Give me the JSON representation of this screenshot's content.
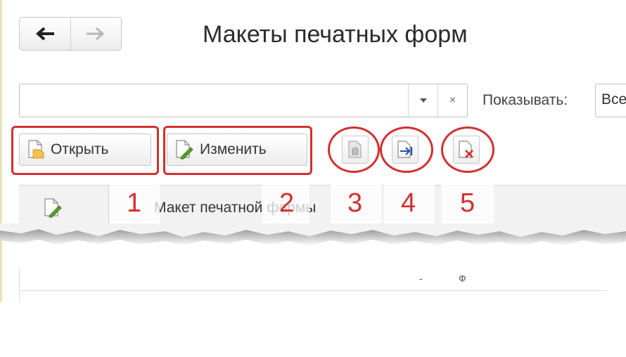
{
  "window": {
    "title": "Макеты печатных форм"
  },
  "nav": {
    "back_icon": "arrow-left-icon",
    "forward_icon": "arrow-right-icon"
  },
  "search": {
    "value": "",
    "placeholder": "",
    "dropdown_icon": "chevron-down-icon",
    "clear_label": "×"
  },
  "filter": {
    "label": "Показывать:",
    "value": "Все"
  },
  "toolbar": {
    "open_label": "Открыть",
    "edit_label": "Изменить",
    "icon3": "use-standard-layout-icon",
    "icon4": "load-layout-icon",
    "icon5": "delete-layout-icon"
  },
  "table": {
    "columns": [
      "Макет печатной формы"
    ]
  },
  "annotations": {
    "numbers": [
      "1",
      "2",
      "3",
      "4",
      "5"
    ],
    "color": "#d32f2f"
  },
  "fragments": [
    "-",
    "Ф"
  ]
}
